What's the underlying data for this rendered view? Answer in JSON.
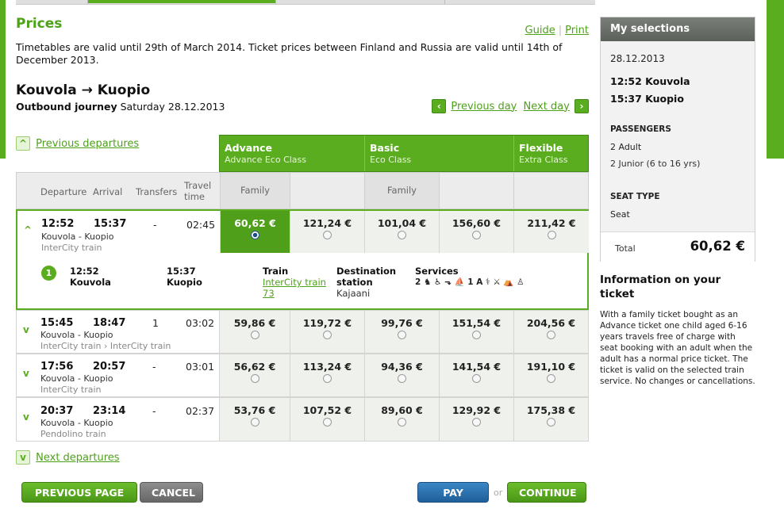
{
  "page": {
    "title": "Prices",
    "links": {
      "guide": "Guide",
      "print": "Print"
    },
    "notice": "Timetables are valid until 29th of March 2014. Ticket prices between Finland and Russia are valid until 14th of December 2013.",
    "route": "Kouvola → Kuopio",
    "outbound_label": "Outbound journey",
    "outbound_date": "Saturday 28.12.2013",
    "prev_day": "Previous day",
    "next_day": "Next day",
    "prev_departures": "Previous departures",
    "next_departures": "Next departures"
  },
  "fare_classes": [
    {
      "name": "Advance",
      "desc": "Advance Eco Class"
    },
    {
      "name": "Basic",
      "desc": "Eco Class"
    },
    {
      "name": "Flexible",
      "desc": "Extra Class"
    }
  ],
  "columns": {
    "departure": "Departure",
    "arrival": "Arrival",
    "transfers": "Transfers",
    "travel_time": "Travel time",
    "family_1": "Family",
    "family_2": "Family"
  },
  "rows": [
    {
      "dep": "12:52",
      "arr": "15:37",
      "route": "Kouvola - Kuopio",
      "type": "InterCity train",
      "transfers": "-",
      "time": "02:45",
      "prices": [
        "60,62 €",
        "121,24 €",
        "101,04 €",
        "156,60 €",
        "211,42 €"
      ]
    },
    {
      "dep": "15:45",
      "arr": "18:47",
      "route": "Kouvola - Kuopio",
      "type": "InterCity train › InterCity train",
      "transfers": "1",
      "time": "03:02",
      "prices": [
        "59,86 €",
        "119,72 €",
        "99,76 €",
        "151,54 €",
        "204,56 €"
      ]
    },
    {
      "dep": "17:56",
      "arr": "20:57",
      "route": "Kouvola - Kuopio",
      "type": "InterCity train",
      "transfers": "-",
      "time": "03:01",
      "prices": [
        "56,62 €",
        "113,24 €",
        "94,36 €",
        "141,54 €",
        "191,10 €"
      ]
    },
    {
      "dep": "20:37",
      "arr": "23:14",
      "route": "Kouvola - Kuopio",
      "type": "Pendolino train",
      "transfers": "-",
      "time": "02:37",
      "prices": [
        "53,76 €",
        "107,52 €",
        "89,60 €",
        "129,92 €",
        "175,38 €"
      ]
    }
  ],
  "detail": {
    "step": "1",
    "dep_time": "12:52",
    "dep_station": "Kouvola",
    "arr_time": "15:37",
    "arr_station": "Kuopio",
    "train_label": "Train",
    "train_link": "InterCity train 73",
    "dest_label": "Destination station",
    "dest_value": "Kajaani",
    "services_label": "Services",
    "services_icons": "2 ♞ ♿ ⬎ ⛵ 1 A ⚕ ⚔ ⛺ ♙"
  },
  "buttons": {
    "previous_page": "PREVIOUS PAGE",
    "cancel": "CANCEL",
    "pay_now": "PAY NOW",
    "or": "or",
    "continue": "CONTINUE"
  },
  "selections": {
    "title": "My selections",
    "date": "28.12.2013",
    "dep": "12:52 Kouvola",
    "arr": "15:37 Kuopio",
    "passengers_label": "PASSENGERS",
    "adults": "2 Adult",
    "juniors": "2 Junior (6 to 16 yrs)",
    "seat_label": "SEAT TYPE",
    "seat_value": "Seat",
    "total_label": "Total",
    "total_value": "60,62 €"
  },
  "info": {
    "heading": "Information on your ticket",
    "body": "With a family ticket bought as an Advance ticket one child aged 6-16 years travels free of charge with seat booking with an adult when the adult has a normal price ticket. The ticket is valid on the selected train service. No changes or cancellations."
  },
  "colors": {
    "accent": "#5aad1f",
    "blue": "#1f5f99",
    "grey": "#6d6d6d"
  }
}
